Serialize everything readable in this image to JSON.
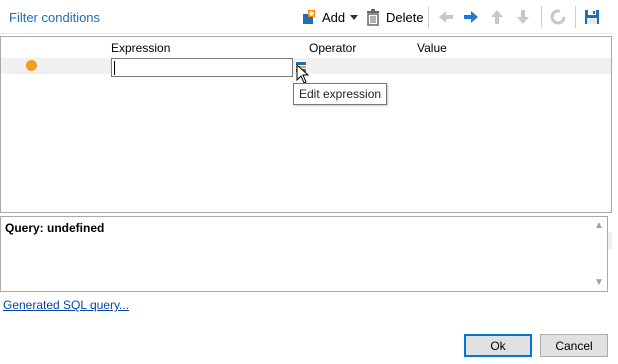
{
  "toolbar": {
    "title": "Filter conditions",
    "add_label": "Add",
    "delete_label": "Delete",
    "icons": [
      "add-icon",
      "dropdown-arrow-icon",
      "trash-icon",
      "arrow-left-icon",
      "arrow-right-icon",
      "arrow-up-icon",
      "arrow-down-icon",
      "refresh-icon",
      "save-icon"
    ],
    "accent_color": "#1f6fb2"
  },
  "grid": {
    "columns": [
      "Expression",
      "Operator",
      "Value"
    ],
    "rows": [
      {
        "status_color": "#f0a01c",
        "expression": "",
        "operator": "",
        "value": ""
      }
    ],
    "tooltip": "Edit expression"
  },
  "query": {
    "text": "Query: undefined"
  },
  "footer": {
    "sql_link": "Generated SQL query...",
    "ok_label": "Ok",
    "cancel_label": "Cancel"
  }
}
